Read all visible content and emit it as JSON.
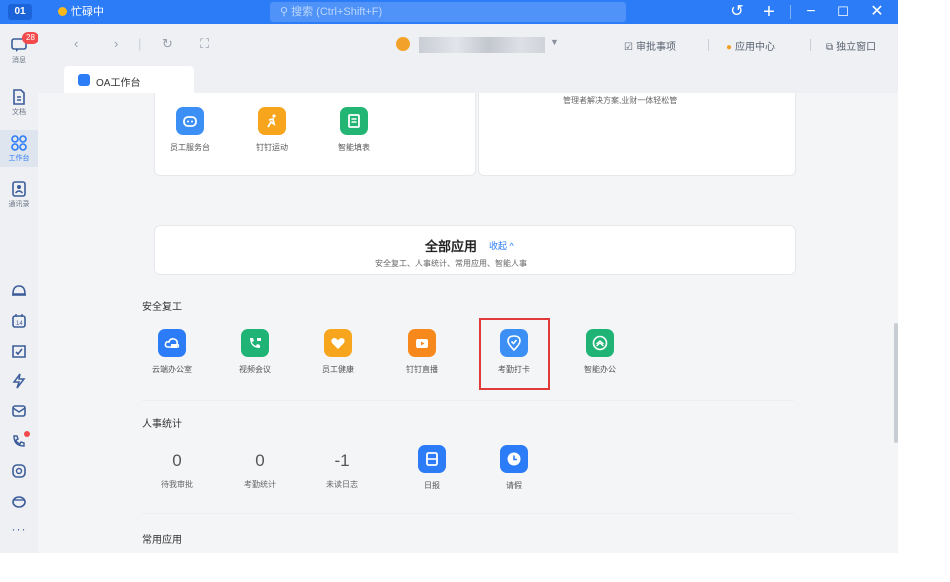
{
  "titlebar": {
    "user_initials": "01",
    "status": "忙碌中",
    "search_placeholder": "搜索 (Ctrl+Shift+F)"
  },
  "sidebar": {
    "items": [
      {
        "label": "消息",
        "badge": "28"
      },
      {
        "label": "文档"
      },
      {
        "label": "工作台"
      },
      {
        "label": "通讯录"
      }
    ]
  },
  "topnav": {
    "approval": "审批事项",
    "app_center": "应用中心",
    "standalone": "独立窗口"
  },
  "tab": {
    "label": "OA工作台"
  },
  "top_banner_text": "管理者解决方案,业财一体轻松管",
  "top_apps": [
    {
      "name": "员工服务台",
      "color": "#3b8ff5",
      "icon": "service-robot-icon"
    },
    {
      "name": "钉钉运动",
      "color": "#f7a51c",
      "icon": "running-icon"
    },
    {
      "name": "智能填表",
      "color": "#22b573",
      "icon": "form-icon"
    }
  ],
  "all_apps": {
    "title": "全部应用",
    "collapse": "收起 ^",
    "subtitle": "安全复工、人事统计、常用应用、智能人事"
  },
  "sections": {
    "safety": {
      "title": "安全复工",
      "apps": [
        {
          "name": "云端办公室",
          "color": "#2b7cf6",
          "icon": "cloud-office-icon"
        },
        {
          "name": "视频会议",
          "color": "#1fb376",
          "icon": "video-call-icon"
        },
        {
          "name": "员工健康",
          "color": "#f7a51c",
          "icon": "heart-icon"
        },
        {
          "name": "钉钉直播",
          "color": "#f7891c",
          "icon": "live-icon"
        },
        {
          "name": "考勤打卡",
          "color": "#3b8ff5",
          "icon": "checkin-icon"
        },
        {
          "name": "智能办公",
          "color": "#1fb376",
          "icon": "smart-office-icon"
        }
      ]
    },
    "hr": {
      "title": "人事统计",
      "stats": [
        {
          "value": "0",
          "name": "待我审批"
        },
        {
          "value": "0",
          "name": "考勤统计"
        },
        {
          "value": "-1",
          "name": "未读日志"
        }
      ],
      "apps": [
        {
          "name": "日报",
          "color": "#2b7cf6",
          "icon": "daily-report-icon"
        },
        {
          "name": "请假",
          "color": "#2b7cf6",
          "icon": "leave-clock-icon"
        }
      ]
    },
    "common": {
      "title": "常用应用"
    }
  }
}
